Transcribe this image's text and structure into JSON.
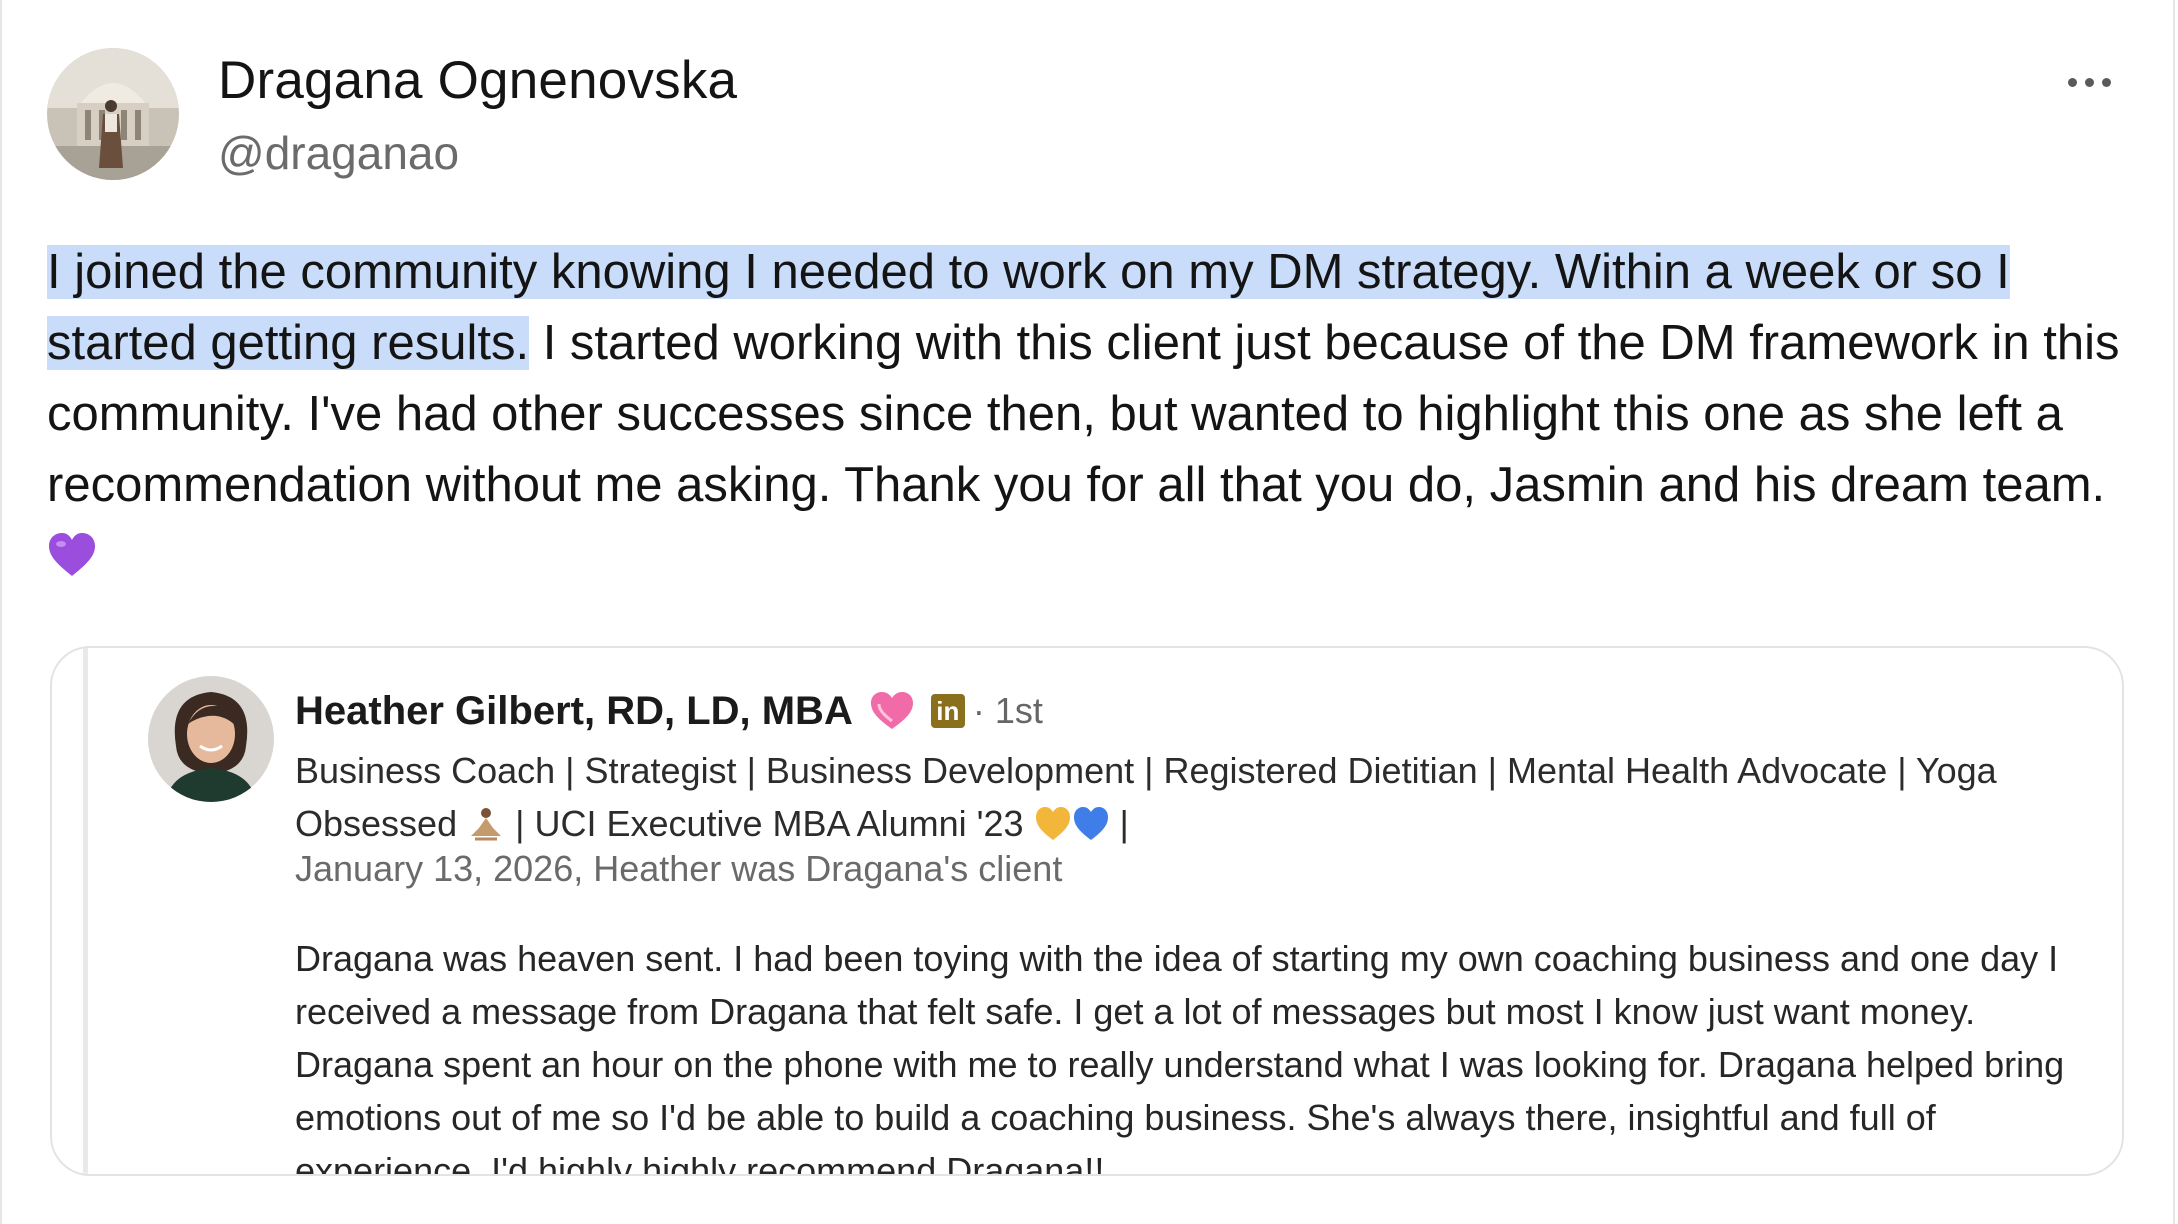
{
  "post": {
    "author_name": "Dragana Ognenovska",
    "author_handle": "@draganao",
    "more_label": "More options",
    "body_highlighted": "I joined the community knowing I needed to work on my DM strategy. Within a week or so I started getting results.",
    "body_rest": " I started working with this client just because of the DM framework in this community. I've had other successes since then, but wanted to highlight this one as she left a recommendation without me asking. Thank you for all that you do, Jasmin and his dream team. ",
    "body_emoji": "purple-heart-icon"
  },
  "recommendation": {
    "name": "Heather Gilbert, RD, LD, MBA",
    "name_emoji": "pink-heart-icon",
    "network_badge": "in",
    "degree": "· 1st",
    "headline_part1": "Business Coach | Strategist | Business Development | Registered Dietitian | Mental Health Advocate | Yoga Obsessed ",
    "headline_emoji1": "yoga-person-icon",
    "headline_part2": " | UCI Executive MBA Alumni '23 ",
    "headline_emoji2": "yellow-heart-icon",
    "headline_emoji3": "blue-heart-icon",
    "headline_part3": " |",
    "date_line": "January 13, 2026, Heather was Dragana's client",
    "text": "Dragana was heaven sent. I had been toying with the idea of starting my own coaching business and one day I received a message from Dragana that felt safe. I get a lot of messages but most I know just want money. Dragana spent an hour on the phone with me to really understand what I was looking for. Dragana helped bring emotions out of me so I'd be able to build a coaching business. She's always there, insightful and full of experience. I'd highly highly recommend Dragana!!"
  },
  "colors": {
    "highlight": "#c9dcfa",
    "handle": "#6b6b6b",
    "purple_heart": "#9b4dde",
    "linkedin_badge": "#8a6f1c"
  }
}
